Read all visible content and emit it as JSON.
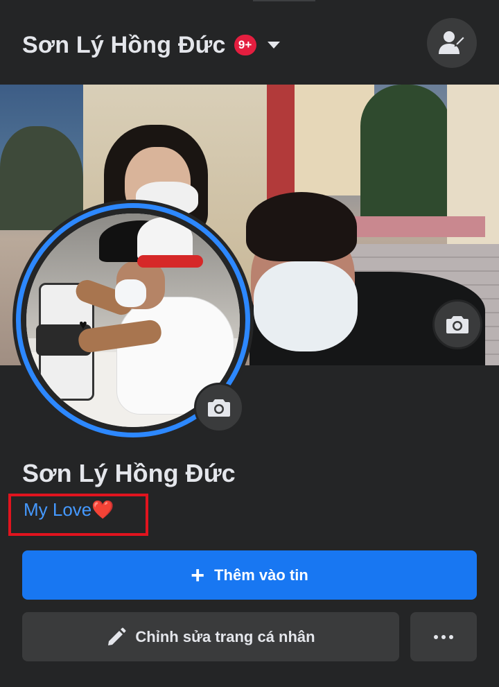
{
  "header": {
    "account_name": "Sơn Lý Hồng Đức",
    "notification_badge": "9+"
  },
  "profile": {
    "name": "Sơn Lý Hồng Đức",
    "bio": "My Love",
    "bio_emoji": "❤️"
  },
  "actions": {
    "add_story_label": "Thêm vào tin",
    "edit_profile_label": "Chỉnh sửa trang cá nhân"
  },
  "colors": {
    "background": "#242526",
    "primary_button": "#1877f2",
    "secondary_button": "#3a3b3c",
    "badge": "#e41e3f",
    "avatar_ring": "#2d88ff",
    "bio_text": "#4599ff",
    "highlight_box": "#e0141e"
  },
  "icons": {
    "header_right": "profile-switch-icon",
    "cover_camera": "camera-icon",
    "avatar_camera": "camera-icon",
    "add_story": "plus-icon",
    "edit_profile": "pencil-icon",
    "more": "more-dots-icon"
  }
}
